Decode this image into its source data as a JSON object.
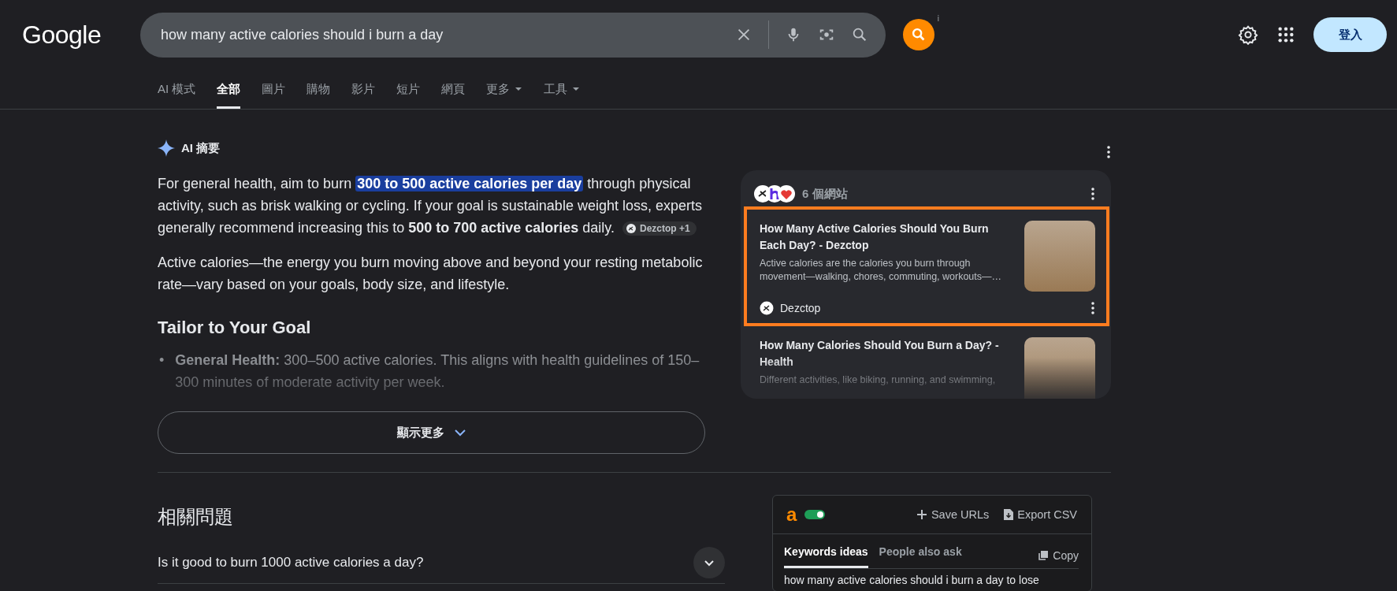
{
  "header": {
    "logo": "Google",
    "search": {
      "value": "how many active calories should i burn a day"
    },
    "extension_badge": "i",
    "sign_in": "登入"
  },
  "tabs": [
    {
      "label": "AI 模式",
      "selected": false,
      "has_menu": false
    },
    {
      "label": "全部",
      "selected": true,
      "has_menu": false
    },
    {
      "label": "圖片",
      "selected": false,
      "has_menu": false
    },
    {
      "label": "購物",
      "selected": false,
      "has_menu": false
    },
    {
      "label": "影片",
      "selected": false,
      "has_menu": false
    },
    {
      "label": "短片",
      "selected": false,
      "has_menu": false
    },
    {
      "label": "網頁",
      "selected": false,
      "has_menu": false
    },
    {
      "label": "更多",
      "selected": false,
      "has_menu": true
    },
    {
      "label": "工具",
      "selected": false,
      "has_menu": true
    }
  ],
  "ai_overview": {
    "title": "AI 摘要",
    "paragraphs": [
      {
        "segments": [
          {
            "kind": "plain",
            "text": "For general health, aim to burn "
          },
          {
            "kind": "highlight",
            "text": "300 to 500 active calories per day"
          },
          {
            "kind": "plain",
            "text": " through physical activity, such as brisk walking or cycling. If your goal is sustainable weight loss, experts generally recommend increasing this to "
          },
          {
            "kind": "bold",
            "text": "500 to 700 active calories"
          },
          {
            "kind": "plain",
            "text": " daily."
          }
        ],
        "citation": "Dezctop +1"
      },
      {
        "segments": [
          {
            "kind": "plain",
            "text": "Active calories—the energy you burn moving above and beyond your resting metabolic rate—vary based on your goals, body size, and lifestyle."
          }
        ]
      }
    ],
    "heading": "Tailor to Your Goal",
    "bullets": [
      {
        "marker": "•",
        "label": "General Health:",
        "text": " 300–500 active calories. This aligns with health guidelines of 150–300 minutes of moderate activity per week."
      }
    ],
    "show_more": "顯示更多"
  },
  "sources": {
    "count": "6 個網站",
    "items": [
      {
        "title": "How Many Active Calories Should You Burn Each Day? - Dezctop",
        "snippet": "Active calories are the calories you burn through movement—walking, chores, commuting, workouts—…",
        "site": "Dezctop",
        "highlighted": true
      },
      {
        "title": "How Many Calories Should You Burn a Day? - Health",
        "snippet": "Different activities, like biking, running, and swimming,",
        "highlighted": false
      }
    ]
  },
  "related": {
    "heading": "相關問題",
    "questions": [
      "Is it good to burn 1000 active calories a day?"
    ]
  },
  "extension": {
    "logo": "a",
    "enabled": true,
    "actions": [
      "Save URLs",
      "Export CSV"
    ],
    "tabs": [
      {
        "label": "Keywords ideas",
        "selected": true
      },
      {
        "label": "People also ask",
        "selected": false
      }
    ],
    "copy": "Copy",
    "keywords": [
      "how many active calories should i burn a day to lose"
    ]
  }
}
